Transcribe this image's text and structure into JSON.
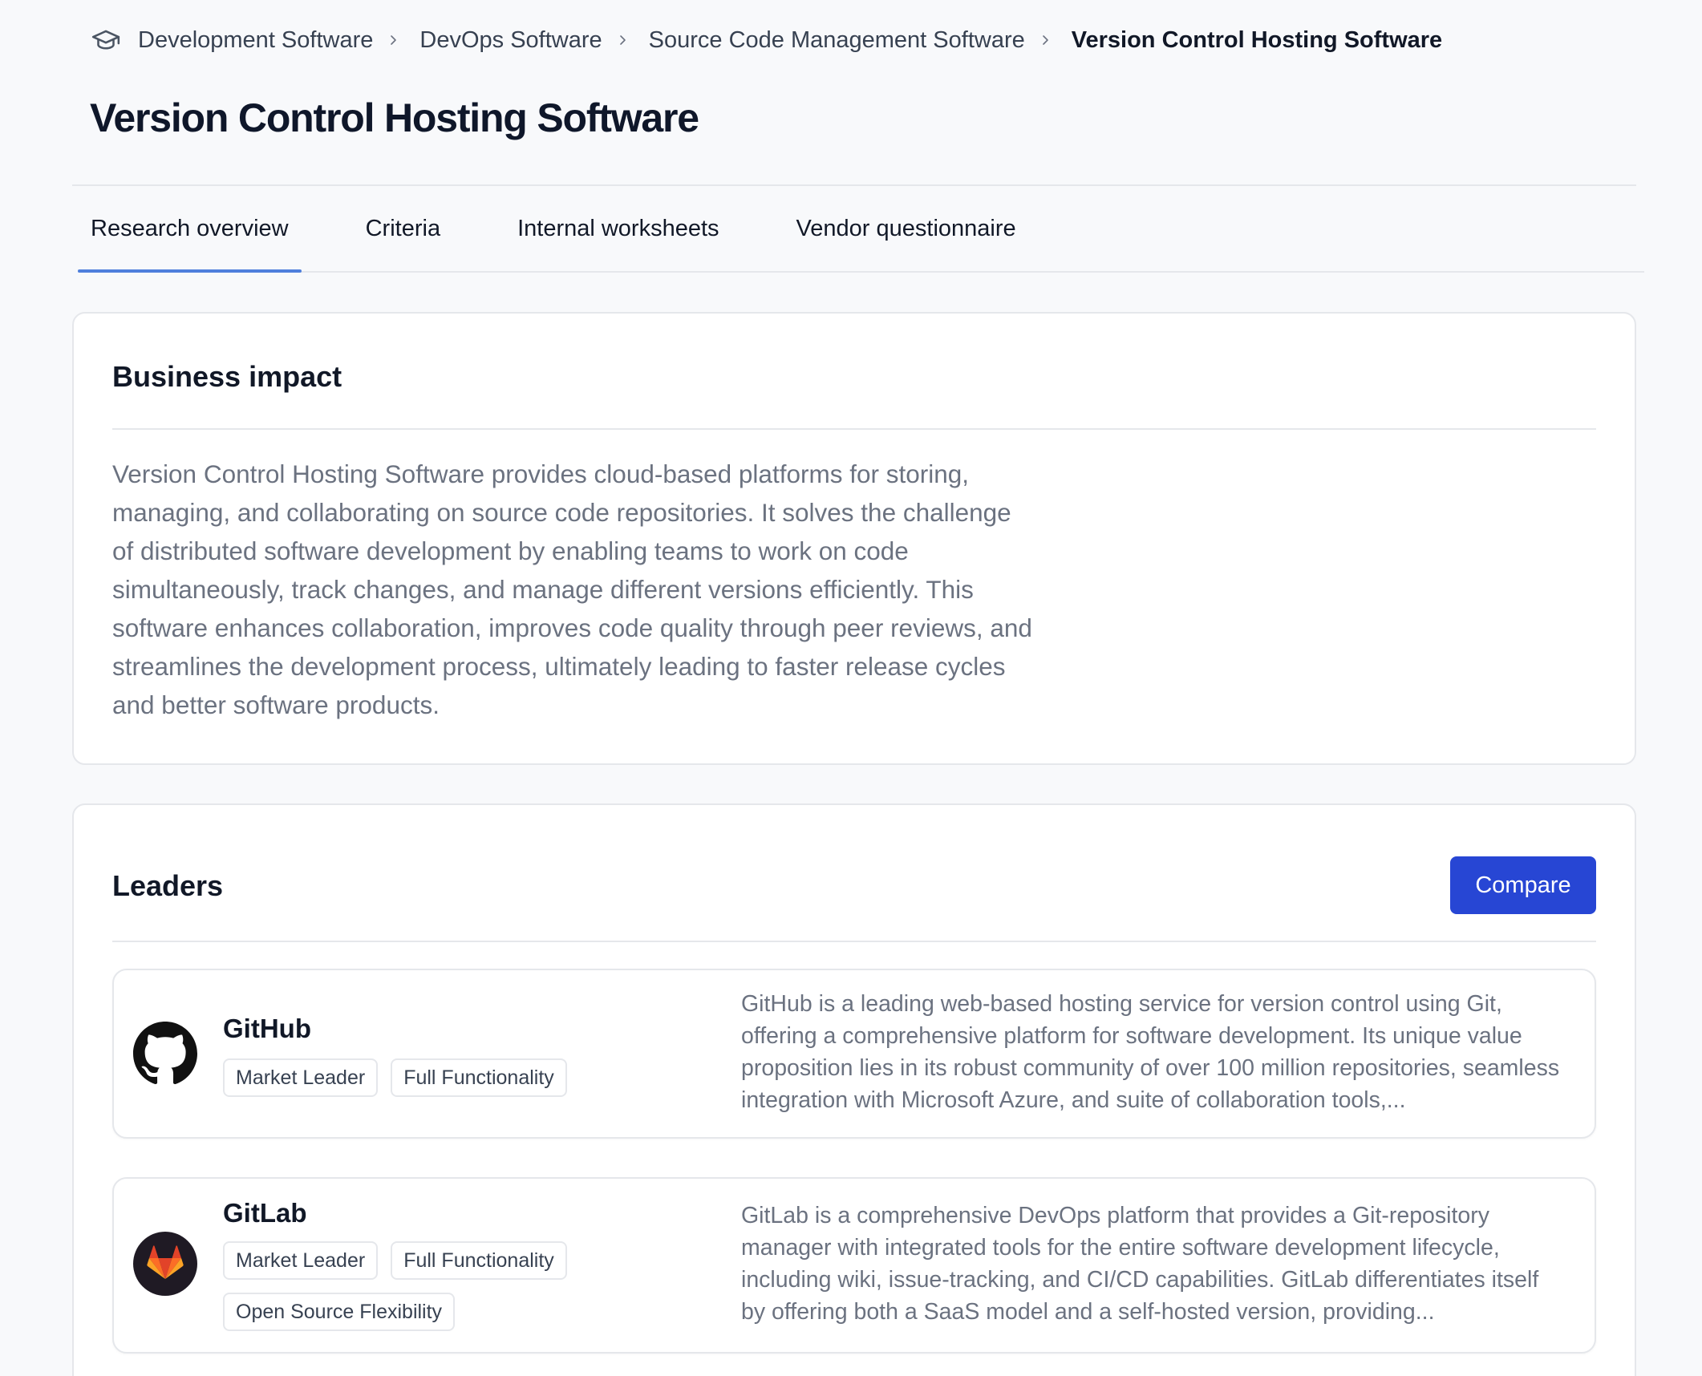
{
  "breadcrumb": {
    "home_icon": "graduation-cap-icon",
    "items": [
      "Development Software",
      "DevOps Software",
      "Source Code Management Software",
      "Version Control Hosting Software"
    ]
  },
  "page": {
    "title": "Version Control Hosting Software"
  },
  "tabs": [
    {
      "label": "Research overview",
      "active": true
    },
    {
      "label": "Criteria",
      "active": false
    },
    {
      "label": "Internal worksheets",
      "active": false
    },
    {
      "label": "Vendor questionnaire",
      "active": false
    }
  ],
  "business_impact": {
    "heading": "Business impact",
    "text": "Version Control Hosting Software provides cloud-based platforms for storing, managing, and collaborating on source code repositories. It solves the challenge of distributed software development by enabling teams to work on code simultaneously, track changes, and manage different versions efficiently. This software enhances collaboration, improves code quality through peer reviews, and streamlines the development process, ultimately leading to faster release cycles and better software products."
  },
  "leaders": {
    "heading": "Leaders",
    "compare_label": "Compare",
    "vendors": [
      {
        "name": "GitHub",
        "logo": "github-icon",
        "badges": [
          "Market Leader",
          "Full Functionality"
        ],
        "description": "GitHub is a leading web-based hosting service for version control using Git, offering a comprehensive platform for software development. Its unique value proposition lies in its robust community of over 100 million repositories, seamless integration with Microsoft Azure, and suite of collaboration tools,..."
      },
      {
        "name": "GitLab",
        "logo": "gitlab-icon",
        "badges": [
          "Market Leader",
          "Full Functionality",
          "Open Source Flexibility"
        ],
        "description": "GitLab is a comprehensive DevOps platform that provides a Git-repository manager with integrated tools for the entire software development lifecycle, including wiki, issue-tracking, and CI/CD capabilities. GitLab differentiates itself by offering both a SaaS model and a self-hosted version, providing..."
      }
    ]
  },
  "colors": {
    "accent_blue": "#2746d4",
    "tab_underline": "#4f7fdc",
    "gitlab_orange": "#e2432a"
  }
}
